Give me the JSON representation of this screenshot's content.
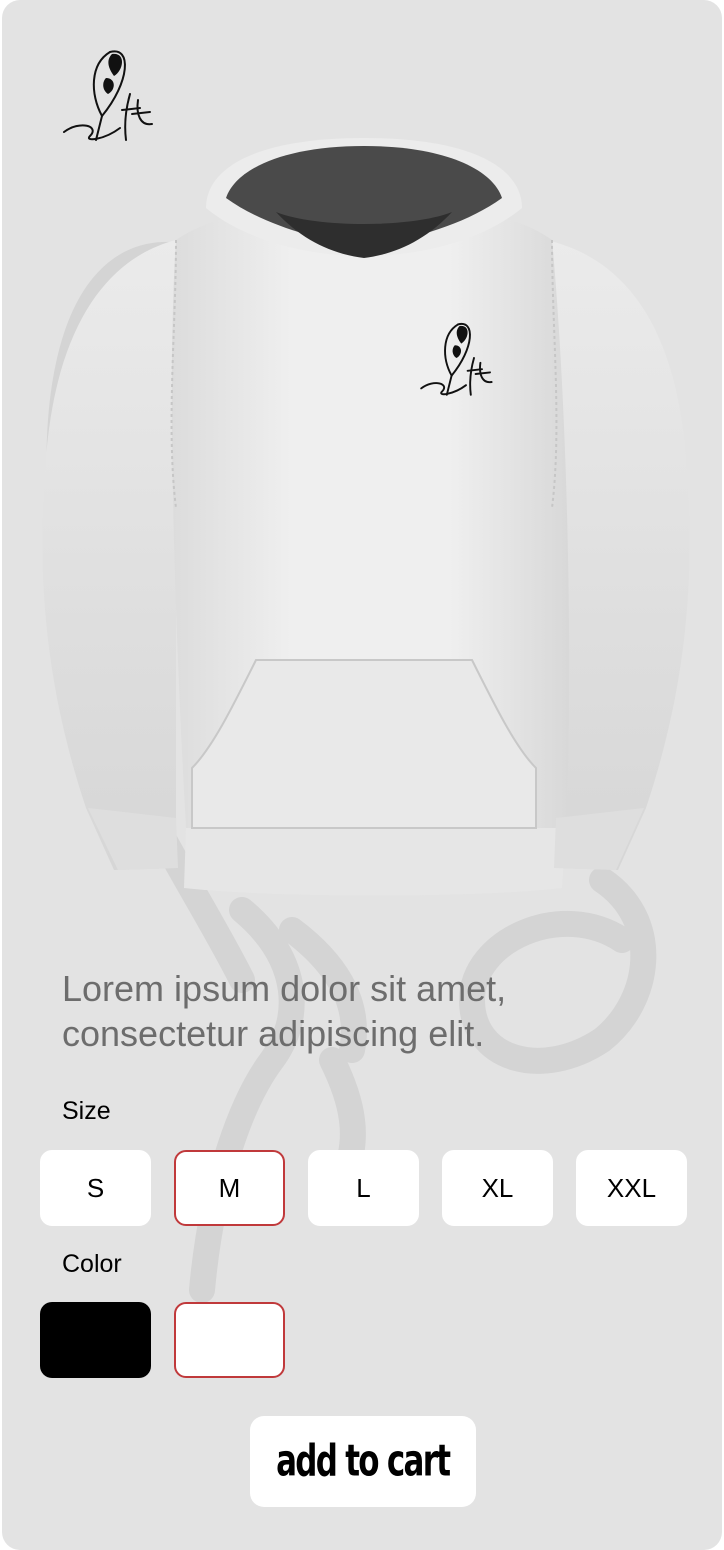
{
  "product": {
    "description": "Lorem ipsum dolor sit amet, consectetur adipiscing elit."
  },
  "size": {
    "label": "Size",
    "options": [
      "S",
      "M",
      "L",
      "XL",
      "XXL"
    ],
    "selected": "M"
  },
  "color": {
    "label": "Color",
    "options": [
      "#000000",
      "#ffffff"
    ],
    "selected": "#ffffff"
  },
  "cart": {
    "button_label": "add to cart"
  },
  "icons": {
    "brand": "feather-signature-logo-icon",
    "product": "hoodie-image"
  },
  "colors": {
    "background": "#e3e3e3",
    "accent": "#c0393b",
    "description_text": "#6d6d6d"
  }
}
